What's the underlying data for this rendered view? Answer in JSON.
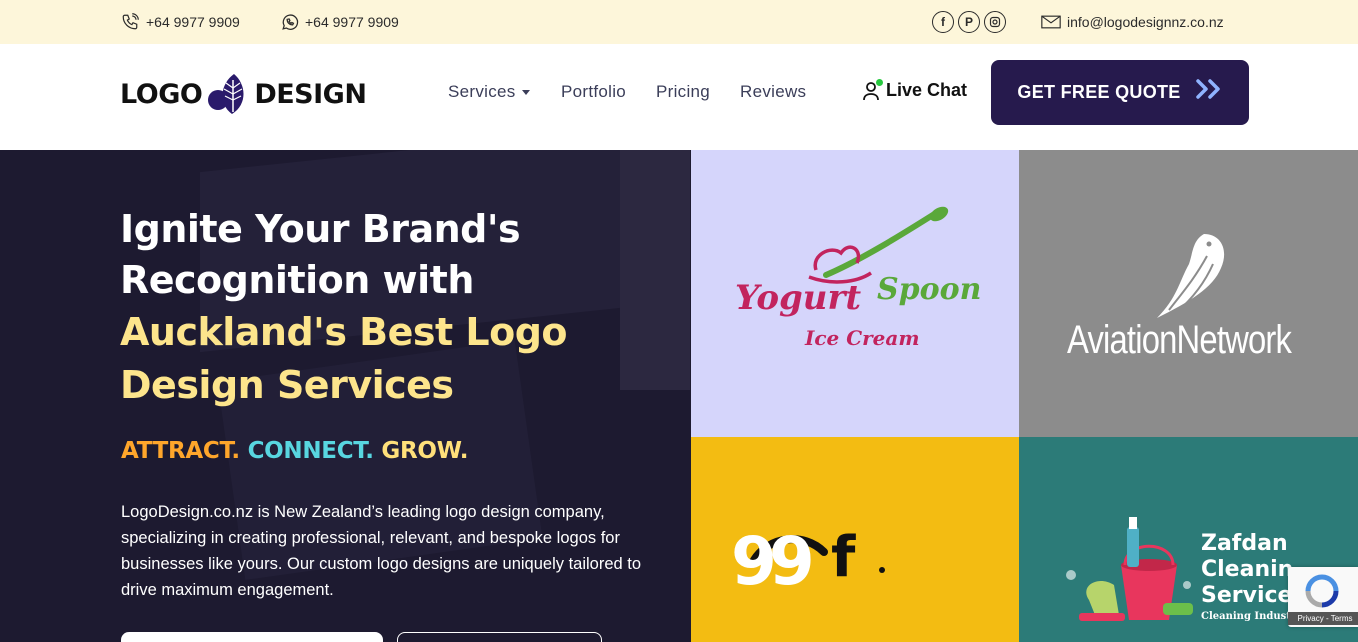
{
  "topbar": {
    "phone": "+64 9977 9909",
    "whatsapp": "+64 9977 9909",
    "social_icons": [
      "facebook-icon",
      "pinterest-icon",
      "instagram-icon"
    ],
    "email": "info@logodesignnz.co.nz"
  },
  "header": {
    "logo_left": "LOGO",
    "logo_right": "DESIGN",
    "nav": [
      {
        "label": "Services",
        "has_dropdown": true
      },
      {
        "label": "Portfolio"
      },
      {
        "label": "Pricing"
      },
      {
        "label": "Reviews"
      }
    ],
    "live_chat": "Live Chat",
    "cta": "GET FREE QUOTE",
    "colors": {
      "cta_bg": "#261a4d",
      "online": "#27c93f",
      "topbar_bg": "#fdf6da"
    }
  },
  "hero": {
    "line1": "Ignite Your Brand's",
    "line2": "Recognition with",
    "line3": "Auckland's Best Logo",
    "line4": "Design Services",
    "tag_attract": "ATTRACT.",
    "tag_connect": "CONNECT.",
    "tag_grow": "GROW.",
    "description": "LogoDesign.co.nz is New Zealand’s leading logo design company, specializing in creating professional, relevant, and bespoke logos for businesses like yours. Our custom logo designs are uniquely tailored to drive maximum engagement.",
    "colors": {
      "bg": "#1d1a30",
      "highlight": "#fde58c",
      "attract": "#ffa62b",
      "connect": "#58d6e0",
      "grow": "#ffe07a"
    }
  },
  "portfolio": {
    "yogurt": {
      "word1": "Yogurt",
      "word2": "Spoon",
      "sub": "Ice Cream"
    },
    "aviation": {
      "name": "AviationNetwork"
    },
    "ninety_nine": {
      "mark": "99",
      "letter": "f"
    },
    "zafdan": {
      "line1": "Zafdan",
      "line2": "Cleanin",
      "line3": "Service",
      "tagline": "Cleaning Industry"
    },
    "colors": {
      "lavender": "#d5d5fb",
      "gray": "#8c8c8c",
      "yellow": "#f3bc12",
      "teal": "#2c7b78"
    }
  },
  "recaptcha": {
    "label": "Privacy - Terms"
  }
}
